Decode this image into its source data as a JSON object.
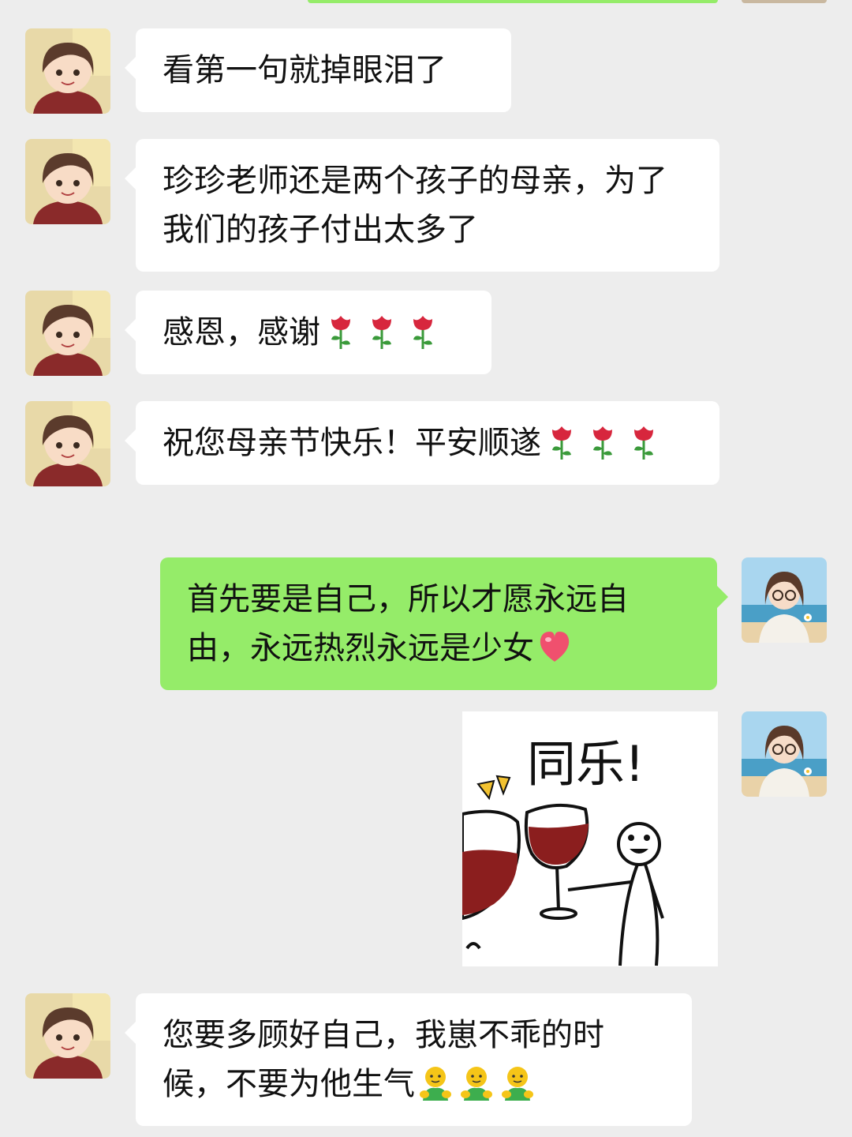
{
  "chat": {
    "messages": [
      {
        "sender": "other",
        "text": "看第一句就掉眼泪了"
      },
      {
        "sender": "other",
        "text": "珍珍老师还是两个孩子的母亲，为了我们的孩子付出太多了"
      },
      {
        "sender": "other",
        "text": "感恩，感谢",
        "emoji": [
          "rose-icon",
          "rose-icon",
          "rose-icon"
        ]
      },
      {
        "sender": "other",
        "text": "祝您母亲节快乐！平安顺遂",
        "emoji": [
          "rose-icon",
          "rose-icon",
          "rose-icon"
        ]
      },
      {
        "sender": "self",
        "text": "首先要是自己，所以才愿永远自由，永远热烈永远是少女",
        "emoji": [
          "heart-icon"
        ]
      },
      {
        "sender": "self",
        "type": "sticker",
        "sticker_text": "同乐!",
        "icon": "wine-toast-sticker"
      },
      {
        "sender": "other",
        "text": "您要多顾好自己，我崽不乖的时候，不要为他生气",
        "emoji": [
          "hug-icon",
          "hug-icon",
          "hug-icon"
        ]
      }
    ]
  },
  "colors": {
    "background": "#ededed",
    "self_bubble": "#95ec69",
    "other_bubble": "#ffffff",
    "text": "#111111",
    "rose": "#d7263d",
    "heart": "#f0506e"
  }
}
